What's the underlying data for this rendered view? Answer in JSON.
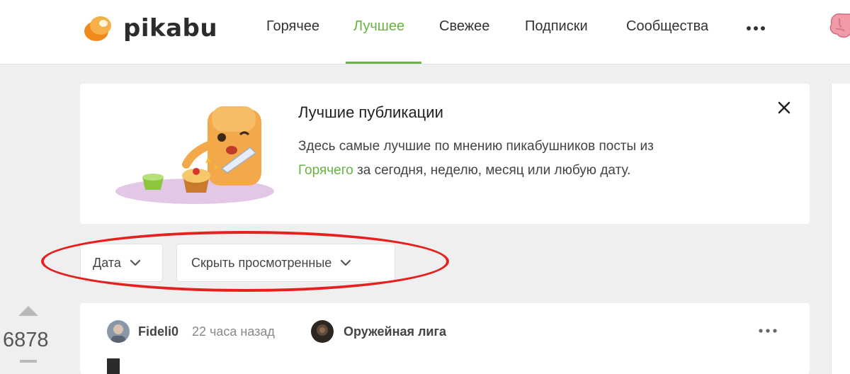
{
  "header": {
    "logo_text": "pikabu",
    "nav": [
      {
        "label": "Горячее",
        "active": false
      },
      {
        "label": "Лучшее",
        "active": true
      },
      {
        "label": "Свежее",
        "active": false
      },
      {
        "label": "Подписки",
        "active": false
      },
      {
        "label": "Сообщества",
        "active": false
      }
    ],
    "more_icon": "dots-icon",
    "accent_color": "#69b246"
  },
  "promo": {
    "title": "Лучшие публикации",
    "text_before": "Здесь самые лучшие по мнению пикабушников посты из",
    "link": "Горячего",
    "text_after": "за сегодня, неделю, месяц или любую дату."
  },
  "filters": {
    "date_label": "Дата",
    "hide_viewed_label": "Скрыть просмотренные",
    "highlight_color": "#e5201e"
  },
  "post": {
    "rating": "6878",
    "author": "Fideli0",
    "time": "22 часа назад",
    "community": "Оружейная лига"
  }
}
